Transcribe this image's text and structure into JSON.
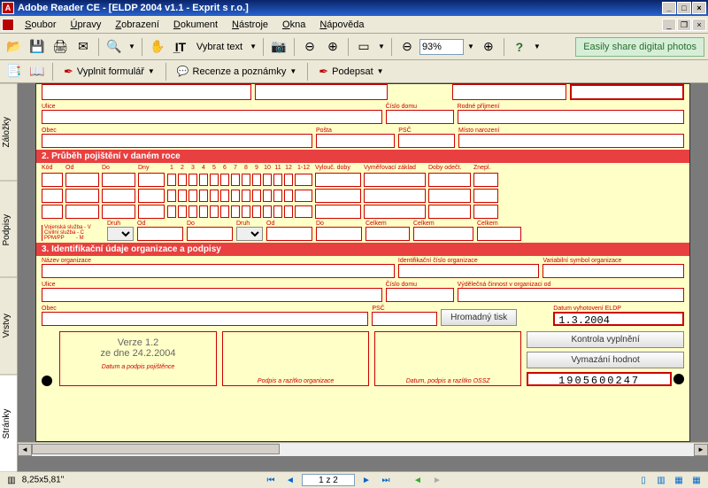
{
  "window": {
    "title": "Adobe Reader CE - [ELDP 2004 v1.1 - Exprit s r.o.]"
  },
  "menubar": {
    "items": [
      "Soubor",
      "Úpravy",
      "Zobrazení",
      "Dokument",
      "Nástroje",
      "Okna",
      "Nápověda"
    ]
  },
  "toolbar": {
    "select_text": "Vybrat text",
    "zoom": "93%",
    "promo": "Easily share digital photos"
  },
  "toolbar2": {
    "fill_form": "Vyplnit formulář",
    "reviews": "Recenze a poznámky",
    "sign": "Podepsat"
  },
  "sidetabs": [
    "Záložky",
    "Podpisy",
    "Vrstvy",
    "Stránky"
  ],
  "form": {
    "row1": {
      "ulice": "Ulice",
      "cislo_domu": "Číslo domu",
      "rodne_prijmeni": "Rodné příjmení"
    },
    "row2": {
      "obec": "Obec",
      "posta": "Pošta",
      "psc": "PSČ",
      "misto_narozeni": "Místo narození"
    },
    "section2": "2. Průběh pojištění v daném roce",
    "sec2_labels": {
      "kod": "Kód",
      "od": "Od",
      "do": "Do",
      "dny": "Dny",
      "vylouc": "Vylouč. doby",
      "vymer": "Vyměřovací základ",
      "doby_odect": "Doby odečt.",
      "znepl": "Znepl."
    },
    "months": [
      "1",
      "2",
      "3",
      "4",
      "5",
      "6",
      "7",
      "8",
      "9",
      "10",
      "11",
      "12",
      "1-12"
    ],
    "legend": "Vojenská služba - V\nCivilní služba - C\nPPM/PP        - M",
    "druh": "Druh",
    "celkem": "Celkem",
    "section3": "3. Identifikační údaje organizace a podpisy",
    "sec3": {
      "nazev": "Název organizace",
      "ico": "Identifikační číslo organizace",
      "varsym": "Variabilní symbol organizace",
      "ulice": "Ulice",
      "cislo_domu": "Číslo domu",
      "vydelecna": "Výdělečná činnost v organizaci od",
      "obec": "Obec",
      "psc": "PSČ",
      "datum_vyhotoveni": "Datum vyhotovení ELDP",
      "datum_value": "1.3.2004",
      "code": "1905600247",
      "verze_line1": "Verze 1.2",
      "verze_line2": "ze dne 24.2.2004",
      "podpis_pojist": "Datum a podpis pojištěnce",
      "podpis_org": "Podpis a razítko organizace",
      "podpis_ossz": "Datum, podpis a razítko OSSZ"
    },
    "buttons": {
      "hromadny": "Hromadný tisk",
      "kontrola": "Kontrola vyplnění",
      "vymazani": "Vymazání hodnot"
    }
  },
  "statusbar": {
    "size": "8,25x5,81\"",
    "page": "1 z 2"
  }
}
